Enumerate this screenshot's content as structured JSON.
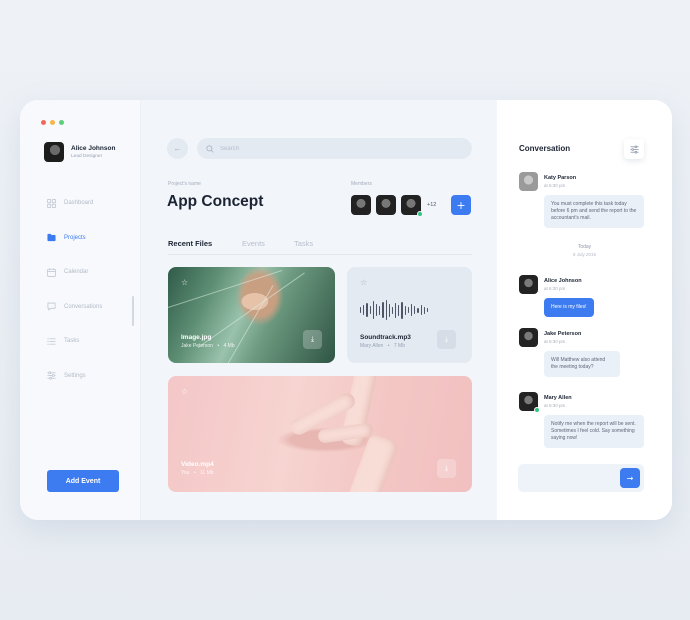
{
  "window": {
    "colors": {
      "close": "#f06a5a",
      "minimize": "#f5b64a",
      "maximize": "#5ccf7a",
      "accent": "#3d7bf1"
    }
  },
  "sidebar": {
    "user": {
      "name": "Alice Johnson",
      "role": "Lead Designer"
    },
    "items": [
      {
        "label": "Dashboard",
        "icon": "grid-icon",
        "active": false
      },
      {
        "label": "Projects",
        "icon": "folder-icon",
        "active": true
      },
      {
        "label": "Calendar",
        "icon": "calendar-icon",
        "active": false
      },
      {
        "label": "Conversations",
        "icon": "chat-icon",
        "active": false
      },
      {
        "label": "Tasks",
        "icon": "list-icon",
        "active": false
      },
      {
        "label": "Settings",
        "icon": "sliders-icon",
        "active": false
      }
    ],
    "add_event_label": "Add Event"
  },
  "main": {
    "search_placeholder": "Search",
    "project_label": "Project's name",
    "project_title": "App Concept",
    "members_label": "Members",
    "members_more": "+12",
    "add_member_label": "+",
    "tabs": [
      {
        "label": "Recent Files",
        "active": true
      },
      {
        "label": "Events",
        "active": false
      },
      {
        "label": "Tasks",
        "active": false
      }
    ],
    "files": [
      {
        "name": "Image.jpg",
        "owner": "Jake Peterson",
        "size": "4 Mb"
      },
      {
        "name": "Soundtrack.mp3",
        "owner": "Mary Allen",
        "size": "7 Mb"
      },
      {
        "name": "Video.mp4",
        "owner": "You",
        "size": "11 Mb"
      }
    ],
    "meta_separator": "•"
  },
  "chat": {
    "title": "Conversation",
    "messages": [
      {
        "name": "Katy Parson",
        "time": "at 6:30 pm",
        "text": "You must complete this task today before 6 pm and send the report to the accountant's mail."
      },
      {
        "name": "Alice Johnson",
        "time": "at 6:30 pm",
        "text": "Here is my files!"
      },
      {
        "name": "Jake Peterson",
        "time": "at 6:30 pm",
        "text": "Will Matthew also attend the meeting today?"
      },
      {
        "name": "Mary Allen",
        "time": "at 6:30 pm",
        "text": "Notify me when the report will be sent. Sometimes I feel cold. Say something saying now!"
      }
    ],
    "day": {
      "label": "Today",
      "date": "8 July 2019"
    },
    "input_placeholder": ""
  }
}
